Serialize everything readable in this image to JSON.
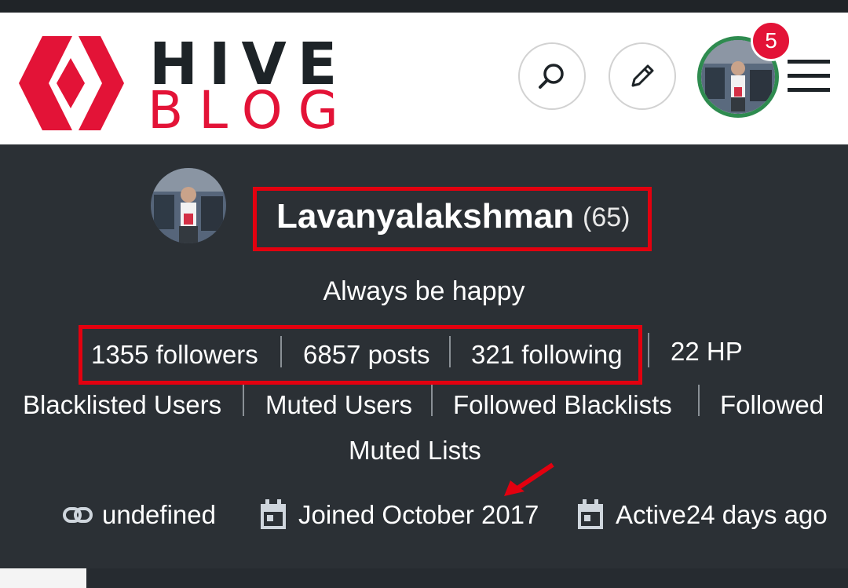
{
  "header": {
    "logo_top": "HIVE",
    "logo_bottom": "BLOG",
    "notification_count": "5"
  },
  "profile": {
    "name": "Lavanyalakshman",
    "reputation": "(65)",
    "about": "Always be happy",
    "stats": {
      "followers": "1355 followers",
      "posts": "6857 posts",
      "following": "321 following",
      "hp": "22 HP"
    },
    "links": {
      "blacklisted": "Blacklisted Users",
      "muted": "Muted Users",
      "followed_blacklists": "Followed Blacklists",
      "followed_muted_1": "Followed",
      "followed_muted_2": "Muted Lists"
    },
    "meta": {
      "website": "undefined",
      "joined": "Joined October 2017",
      "active": "Active24 days ago"
    }
  },
  "colors": {
    "brand_red": "#e31337",
    "annotation_red": "#e3000f",
    "header_bg": "#ffffff",
    "profile_bg": "#2b3035",
    "avatar_ring": "#2e8b4f"
  },
  "icons": [
    "hive-logo-icon",
    "search-icon",
    "pencil-icon",
    "menu-icon",
    "link-icon",
    "calendar-icon"
  ]
}
